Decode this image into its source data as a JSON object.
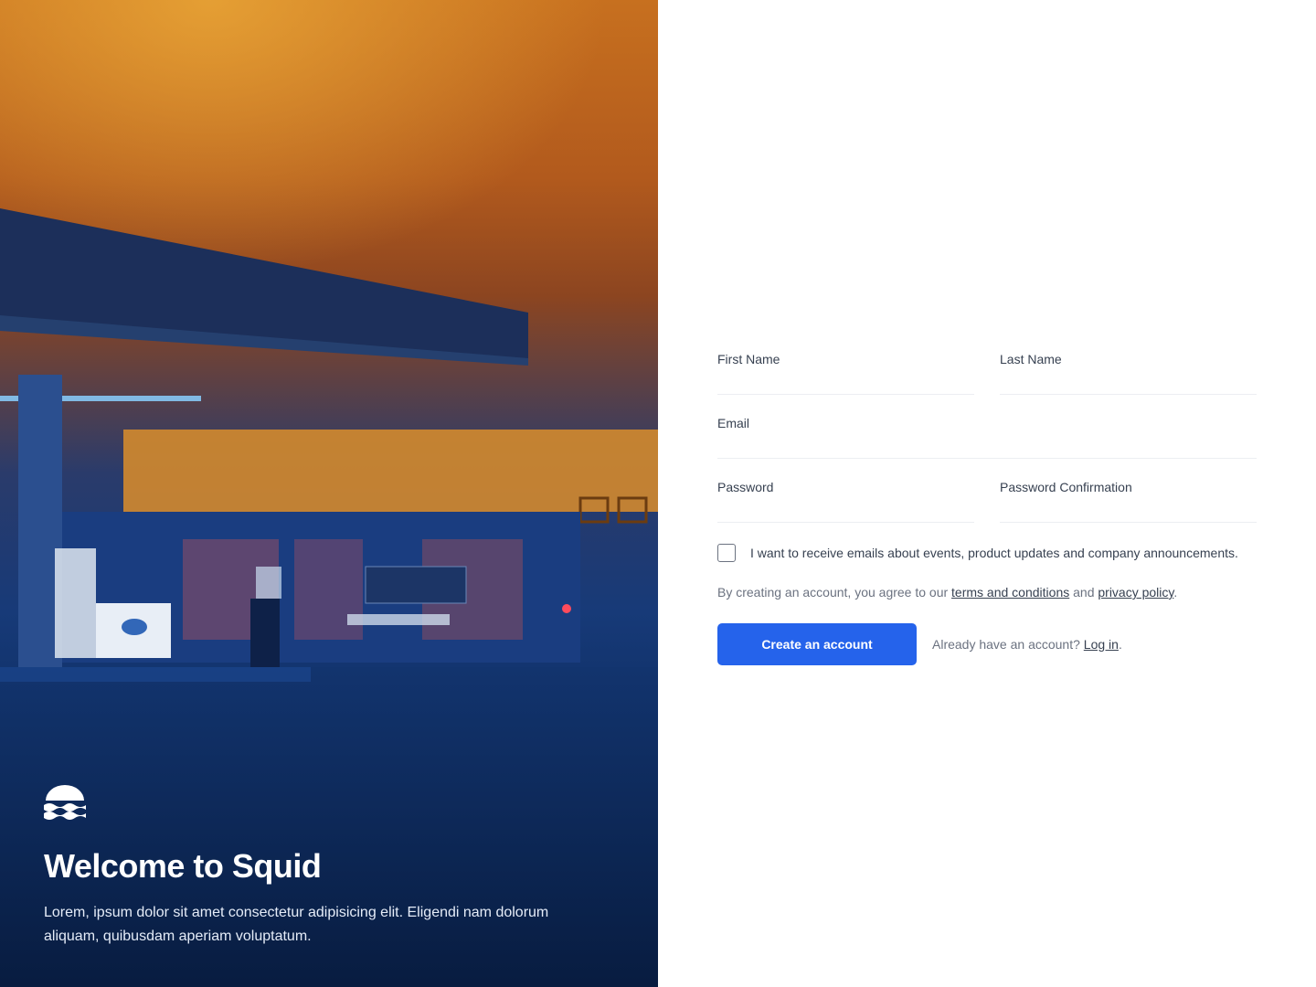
{
  "hero": {
    "title": "Welcome to Squid",
    "description": "Lorem, ipsum dolor sit amet consectetur adipisicing elit. Eligendi nam dolorum aliquam, quibusdam aperiam voluptatum.",
    "logo_icon": "squid-wave-logo-icon",
    "image": "gas-station-night-photo"
  },
  "form": {
    "first_name": {
      "label": "First Name",
      "value": ""
    },
    "last_name": {
      "label": "Last Name",
      "value": ""
    },
    "email": {
      "label": "Email",
      "value": ""
    },
    "password": {
      "label": "Password",
      "value": ""
    },
    "password_confirmation": {
      "label": "Password Confirmation",
      "value": ""
    },
    "marketing_checkbox": {
      "checked": false,
      "label": "I want to receive emails about events, product updates and company announcements."
    },
    "agreement": {
      "prefix": "By creating an account, you agree to our ",
      "terms_link": "terms and conditions",
      "middle": " and ",
      "privacy_link": "privacy policy",
      "suffix": "."
    },
    "submit_label": "Create an account",
    "login_prompt": {
      "prefix": "Already have an account? ",
      "link": "Log in",
      "suffix": "."
    }
  },
  "colors": {
    "primary": "#2563eb",
    "hero_top": "#c7701f",
    "hero_bottom": "#0a244f"
  }
}
